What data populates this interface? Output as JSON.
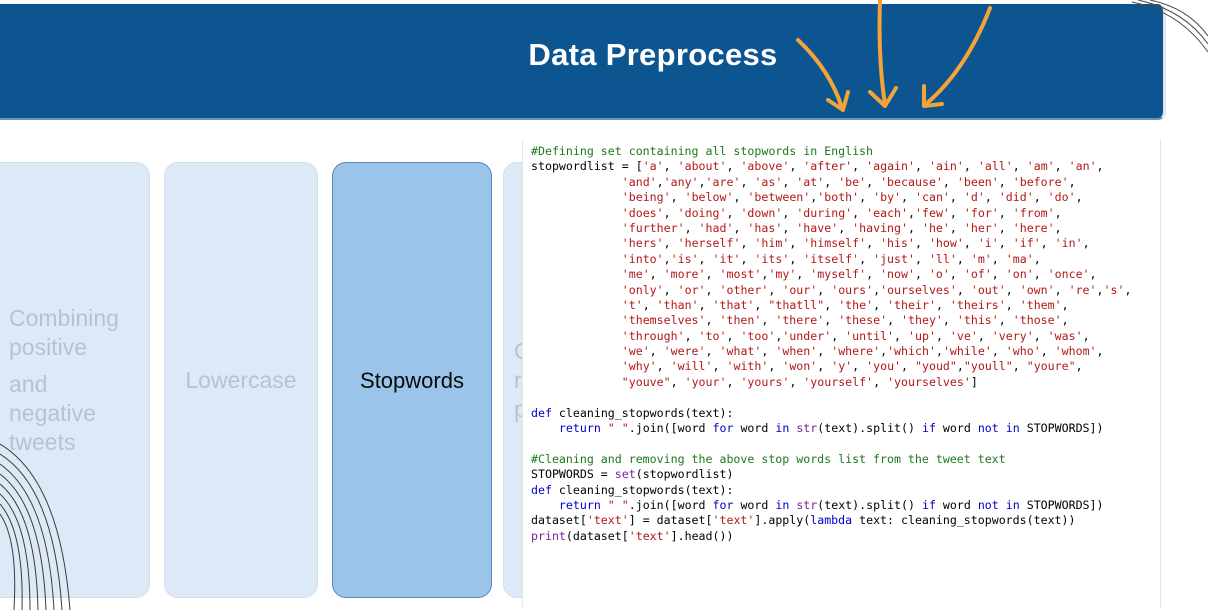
{
  "slide": {
    "title": "Data Preprocess",
    "accent_color": "#0c5590",
    "arrow_color": "#f2a33a"
  },
  "steps": [
    {
      "lines": [
        "Combining",
        "positive",
        "and",
        "negative",
        "tweets"
      ],
      "active": false
    },
    {
      "label": "Lowercase",
      "active": false
    },
    {
      "label": "Stopwords",
      "active": true
    },
    {
      "partial_lines": [
        "C",
        "re",
        "p"
      ],
      "active": false
    }
  ],
  "code_block": {
    "lines": [
      "#Defining set containing all stopwords in English",
      "stopwordlist = ['a', 'about', 'above', 'after', 'again', 'ain', 'all', 'am', 'an',",
      "             'and','any','are', 'as', 'at', 'be', 'because', 'been', 'before',",
      "             'being', 'below', 'between','both', 'by', 'can', 'd', 'did', 'do',",
      "             'does', 'doing', 'down', 'during', 'each','few', 'for', 'from',",
      "             'further', 'had', 'has', 'have', 'having', 'he', 'her', 'here',",
      "             'hers', 'herself', 'him', 'himself', 'his', 'how', 'i', 'if', 'in',",
      "             'into','is', 'it', 'its', 'itself', 'just', 'll', 'm', 'ma',",
      "             'me', 'more', 'most','my', 'myself', 'now', 'o', 'of', 'on', 'once',",
      "             'only', 'or', 'other', 'our', 'ours','ourselves', 'out', 'own', 're','s',",
      "             't', 'than', 'that', \"thatll\", 'the', 'their', 'theirs', 'them',",
      "             'themselves', 'then', 'there', 'these', 'they', 'this', 'those',",
      "             'through', 'to', 'too','under', 'until', 'up', 've', 'very', 'was',",
      "             'we', 'were', 'what', 'when', 'where','which','while', 'who', 'whom',",
      "             'why', 'will', 'with', 'won', 'y', 'you', \"youd\",\"youll\", \"youre\",",
      "             \"youve\", 'your', 'yours', 'yourself', 'yourselves']",
      "",
      "def cleaning_stopwords(text):",
      "    return \" \".join([word for word in str(text).split() if word not in STOPWORDS])",
      "",
      "#Cleaning and removing the above stop words list from the tweet text",
      "STOPWORDS = set(stopwordlist)",
      "def cleaning_stopwords(text):",
      "    return \" \".join([word for word in str(text).split() if word not in STOPWORDS])",
      "dataset['text'] = dataset['text'].apply(lambda text: cleaning_stopwords(text))",
      "print(dataset['text'].head())"
    ]
  }
}
